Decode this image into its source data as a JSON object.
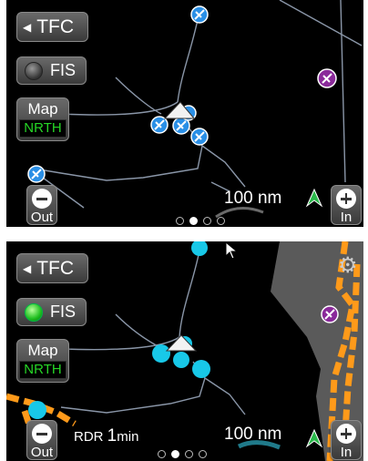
{
  "top_panel": {
    "tfc_label": "TFC",
    "fis_label": "FIS",
    "map_label": "Map",
    "orientation_label": "NRTH",
    "zoom_out_label": "Out",
    "zoom_in_label": "In",
    "scale_label": "100 nm",
    "active_page": 1,
    "page_count": 4
  },
  "bottom_panel": {
    "tfc_label": "TFC",
    "fis_label": "FIS",
    "map_label": "Map",
    "orientation_label": "NRTH",
    "zoom_out_label": "Out",
    "zoom_in_label": "In",
    "scale_label": "100 nm",
    "radar_prefix": "RDR",
    "radar_value": "1",
    "radar_unit": "min",
    "active_page": 1,
    "page_count": 4
  },
  "colors": {
    "airport_blue": "#2a8fe6",
    "airport_cyan": "#18c8e8",
    "special_airport": "#8a2a9a",
    "weather_orange": "#ff9a1a",
    "map_line": "#8a96a8",
    "fis_on": "#1fbf1f",
    "nrth_green": "#26d626"
  },
  "icons": [
    "back-arrow-icon",
    "led-indicator-icon",
    "zoom-out-icon",
    "zoom-in-icon",
    "north-arrow-icon",
    "ownship-icon",
    "airport-icon",
    "gear-icon",
    "cursor-icon"
  ]
}
